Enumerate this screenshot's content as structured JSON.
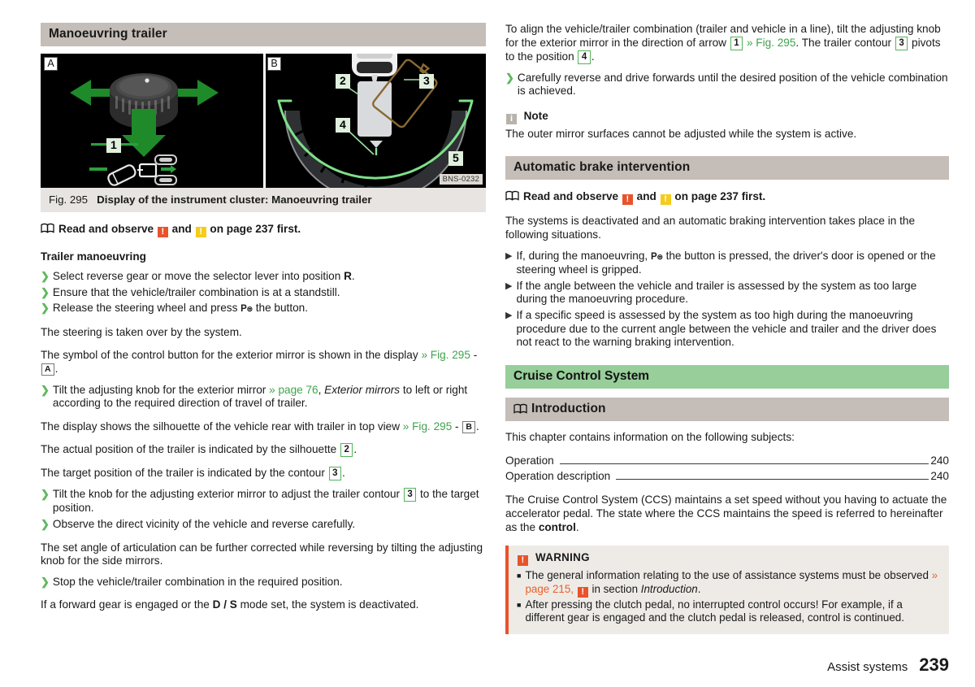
{
  "document": {
    "footer_section": "Assist systems",
    "footer_page": "239"
  },
  "left": {
    "section_heading": "Manoeuvring trailer",
    "figure": {
      "panel_a_label": "A",
      "panel_b_label": "B",
      "image_code": "BNS-0232",
      "callouts": [
        "1",
        "2",
        "3",
        "4",
        "5"
      ],
      "caption_prefix": "Fig. 295",
      "caption_text": "Display of the instrument cluster: Manoeuvring trailer"
    },
    "read_observe": {
      "pre": "Read and observe",
      "mid": "and",
      "post": "on page 237 first."
    },
    "subheading": "Trailer manoeuvring",
    "steps": [
      {
        "text_a": "Select reverse gear or move the selector lever into position ",
        "bold": "R",
        "text_b": "."
      },
      {
        "text_a": "Ensure that the vehicle/trailer combination is at a standstill.",
        "bold": "",
        "text_b": ""
      },
      {
        "text_a": "Release the steering wheel and press ",
        "bold": "",
        "text_b": " the button.",
        "symbol": "Pe"
      }
    ],
    "para_steering": "The steering is taken over by the system.",
    "para_symbol": {
      "text": "The symbol of the control button for the exterior mirror is shown in the display ",
      "ref": "» Fig. 295",
      "sep": " - ",
      "box": "A",
      "end": "."
    },
    "step_tilt": {
      "a": "Tilt the adjusting knob for the exterior mirror ",
      "link": "» page 76",
      "b": ", ",
      "italic": "Exterior mirrors",
      "c": " to left or right according to the required direction of travel of trailer."
    },
    "para_display": {
      "text": "The display shows the silhouette of the vehicle rear with trailer in top view ",
      "ref": "» Fig. 295",
      "sep": " - ",
      "box": "B",
      "end": "."
    },
    "para_actual": {
      "a": "The actual position of the trailer is indicated by the silhouette ",
      "box": "2",
      "b": "."
    },
    "para_target": {
      "a": "The target position of the trailer is indicated by the contour ",
      "box": "3",
      "b": "."
    },
    "step_contour": {
      "a": "Tilt the knob for the adjusting exterior mirror to adjust the trailer contour ",
      "box": "3",
      "b": " to the target position."
    },
    "step_observe": "Observe the direct vicinity of the vehicle and reverse carefully.",
    "para_angle": "The set angle of articulation can be further corrected while reversing by tilting the adjusting knob for the side mirrors.",
    "step_stop": "Stop the vehicle/trailer combination in the required position.",
    "para_forward": {
      "a": "If a forward gear is engaged or the ",
      "bold": "D / S",
      "b": " mode set, the system is deactivated."
    }
  },
  "right": {
    "para_align": {
      "a": "To align the vehicle/trailer combination (trailer and vehicle in a line), tilt the adjusting knob for the exterior mirror in the direction of arrow ",
      "box1": "1",
      "ref": "» Fig. 295",
      "b": ". The trailer contour ",
      "box2": "3",
      "c": " pivots to the position ",
      "box3": "4",
      "d": "."
    },
    "step_reverse": "Carefully reverse and drive forwards until the desired position of the vehicle combination is achieved.",
    "note": {
      "title": "Note",
      "body": "The outer mirror surfaces cannot be adjusted while the system is active."
    },
    "brake_heading": "Automatic brake intervention",
    "read_observe": {
      "pre": "Read and observe",
      "mid": "and",
      "post": "on page 237 first."
    },
    "para_deactivated": "The systems is deactivated and an automatic braking intervention takes place in the following situations.",
    "brake_bullets": [
      {
        "a": "If, during the manoeuvring, ",
        "symbol": "Pe",
        "b": " the button is pressed, the driver's door is opened or the steering wheel is gripped."
      },
      {
        "a": "If the angle between the vehicle and trailer is assessed by the system as too large during the manoeuvring procedure.",
        "symbol": "",
        "b": ""
      },
      {
        "a": "If a specific speed is assessed by the system as too high during the manoeuvring procedure due to the current angle between the vehicle and trailer and the driver does not react to the warning braking intervention.",
        "symbol": "",
        "b": ""
      }
    ],
    "ccs_heading": "Cruise Control System",
    "intro_heading": "Introduction",
    "intro_lead": "This chapter contains information on the following subjects:",
    "toc": [
      {
        "label": "Operation",
        "page": "240"
      },
      {
        "label": "Operation description",
        "page": "240"
      }
    ],
    "para_ccs": {
      "a": "The Cruise Control System (CCS) maintains a set speed without you having to actuate the accelerator pedal. The state where the CCS maintains the speed is referred to hereinafter as the ",
      "bold": "control",
      "b": "."
    },
    "warning": {
      "title": "WARNING",
      "bullets": [
        {
          "a": "The general information relating to the use of assistance systems must be observed ",
          "link": "» page 215,",
          "b": " in section ",
          "italic": "Introduction",
          "c": "."
        },
        {
          "a": "After pressing the clutch pedal, no interrupted control occurs! For example, if a different gear is engaged and the clutch pedal is released, control is continued.",
          "link": "",
          "b": "",
          "italic": "",
          "c": ""
        }
      ]
    }
  }
}
